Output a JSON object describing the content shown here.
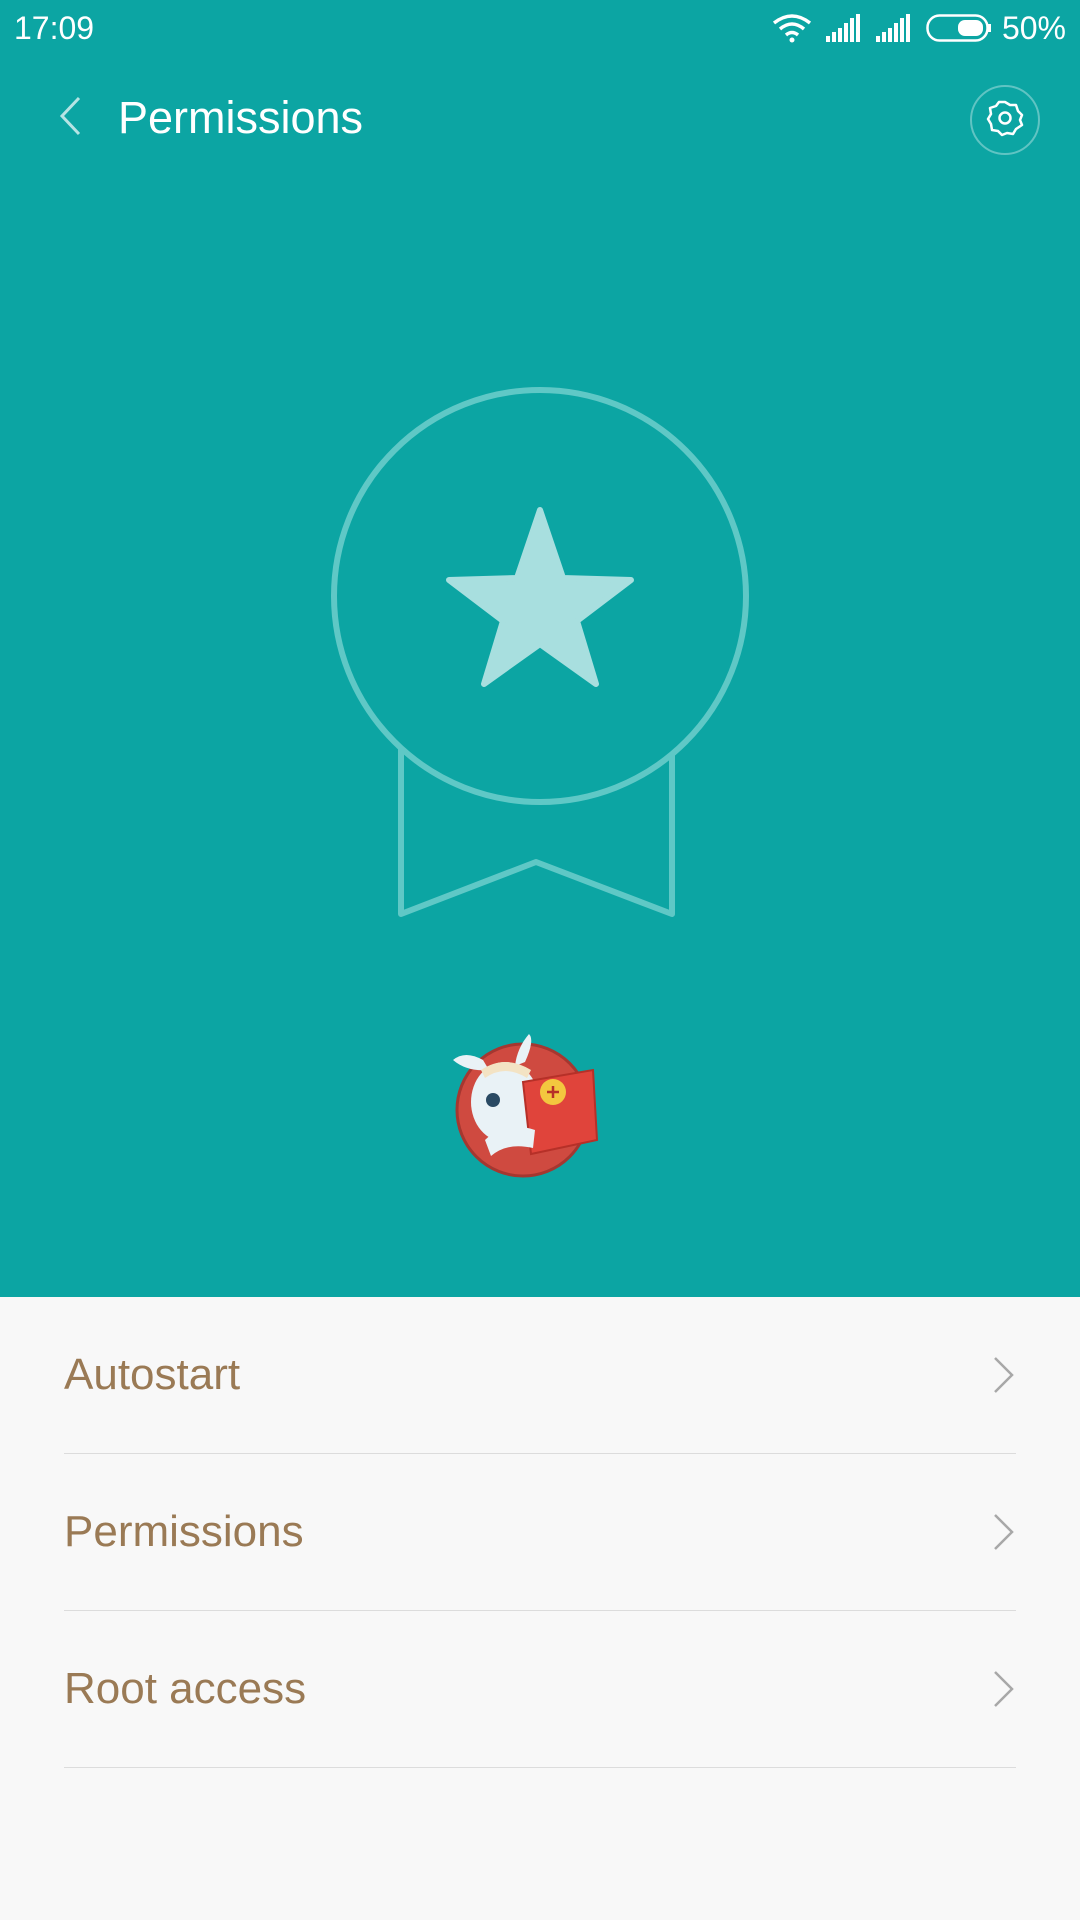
{
  "status_bar": {
    "time": "17:09",
    "battery_percent_text": "50%",
    "icons": [
      "wifi-icon",
      "signal-icon",
      "signal-icon",
      "battery-icon"
    ]
  },
  "header": {
    "title": "Permissions",
    "back_icon": "chevron-left-icon",
    "settings_icon": "gear-icon"
  },
  "hero": {
    "background_color": "#0ca5a3",
    "badge_icon": "award-star-icon",
    "mascot": "mascot-avatar"
  },
  "list": {
    "items": [
      {
        "label": "Autostart"
      },
      {
        "label": "Permissions"
      },
      {
        "label": "Root access"
      }
    ],
    "label_color": "#9a7a55"
  }
}
